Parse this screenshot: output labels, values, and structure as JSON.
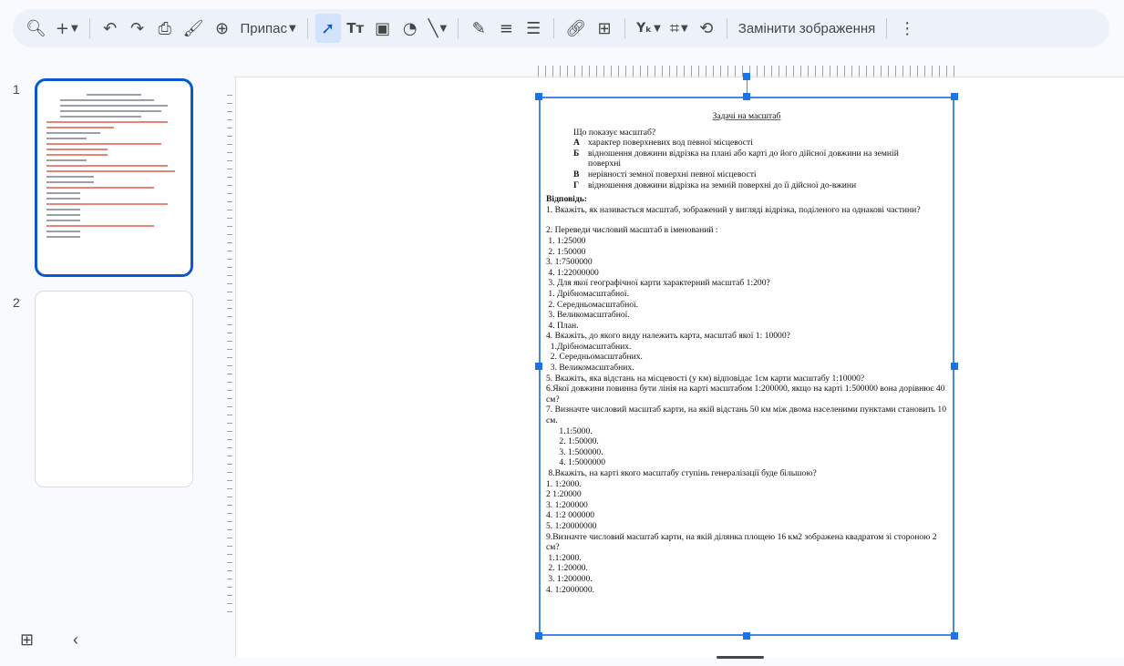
{
  "toolbar": {
    "zoom_menu_label": "Припас",
    "replace_image_label": "Замінити зображення"
  },
  "filmstrip": {
    "slides": [
      {
        "number": "1"
      },
      {
        "number": "2"
      }
    ]
  },
  "document": {
    "title": "Задачі на масштаб",
    "question": "Що показує масштаб?",
    "options": [
      {
        "letter": "А",
        "text": "характер поверхневих вод певної місцевості"
      },
      {
        "letter": "Б",
        "text": "відношення довжини відрізка на плані або карті до його дійсної довжини на земній поверхні"
      },
      {
        "letter": "В",
        "text": "нерівності земної поверхні певної місцевості"
      },
      {
        "letter": "Г",
        "text": "відношення довжини відрізка на земній поверхні до її дійсної до-вжини"
      }
    ],
    "answer_heading": "Відповідь:",
    "lines": [
      "1. Вкажіть, як називається масштаб, зображений у вигляді відрізка, поділеного на однакові частини?",
      "",
      "2. Переведи числовий масштаб в іменований :",
      " 1. 1:25000",
      " 2. 1:50000",
      "3. 1:7500000",
      " 4. 1:22000000",
      " 3. Для якої географічної карти характерний масштаб 1:200?",
      " 1. Дрібномасштабної.",
      " 2. Середньомасштабної.",
      " 3. Великомасштабної.",
      " 4. План.",
      "4. Вкажіть, до якого виду належить карта, масштаб якої 1: 10000?",
      "  1.Дрібномасштабних.",
      "  2. Середньомасштабних.",
      "  3. Великомасштабних.",
      "5. Вкажіть, яка відстань на місцевості (у км) відповідає 1см карти масштабу 1:10000?",
      "6.Якої довжини повинна бути лінія на карті масштабом 1:200000, якщо на карті 1:500000 вона дорівнює 40 см?",
      "7. Визначте числовий масштаб карти, на якій відстань 50 км між двома населеними пунктами становить 10 см.",
      "      1.1:5000.",
      "      2. 1:50000.",
      "      3. 1:500000.",
      "      4. 1:5000000",
      " 8.Вкажіть, на карті якого масштабу ступінь генералізації буде більшою?",
      "1. 1:2000.",
      "2 1:20000",
      "3. 1:200000",
      "4. 1:2 000000",
      "5. 1:20000000",
      "9.Визначте числовий масштаб карти, на якій ділянка площею 16 км2 зображена квадратом зі стороною 2 см?",
      " 1.1:2000.",
      " 2. 1:20000.",
      " 3. 1:200000.",
      "4. 1:2000000."
    ]
  },
  "colors": {
    "accent": "#0b57d0",
    "selection": "#4a86e8",
    "toolbar_bg": "#edf2fa"
  }
}
